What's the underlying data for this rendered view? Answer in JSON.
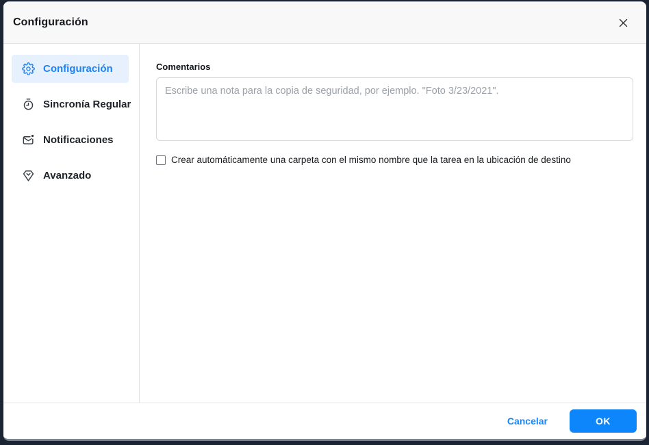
{
  "window": {
    "title": "Configuración"
  },
  "sidebar": {
    "items": [
      {
        "label": "Configuración",
        "icon": "gear-icon",
        "selected": true
      },
      {
        "label": "Sincronía Regular",
        "icon": "stopwatch-icon",
        "selected": false
      },
      {
        "label": "Notificaciones",
        "icon": "mail-notification-icon",
        "selected": false
      },
      {
        "label": "Avanzado",
        "icon": "diamond-icon",
        "selected": false
      }
    ]
  },
  "main": {
    "comments_label": "Comentarios",
    "comments_value": "",
    "comments_placeholder": "Escribe una nota para la copia de seguridad, por ejemplo. \"Foto 3/23/2021\".",
    "checkbox_label": "Crear automáticamente una carpeta con el mismo nombre que la tarea en la ubicación de destino",
    "checkbox_checked": false
  },
  "footer": {
    "cancel_label": "Cancelar",
    "ok_label": "OK"
  },
  "colors": {
    "accent_blue": "#1e82f0",
    "selected_item_bg": "#e6f1fd",
    "ok_button_bg": "#0d86fb",
    "cancel_text": "#1486fa",
    "frame_dark": "#1a2433",
    "titlebar_bg": "#f8f8f9"
  }
}
